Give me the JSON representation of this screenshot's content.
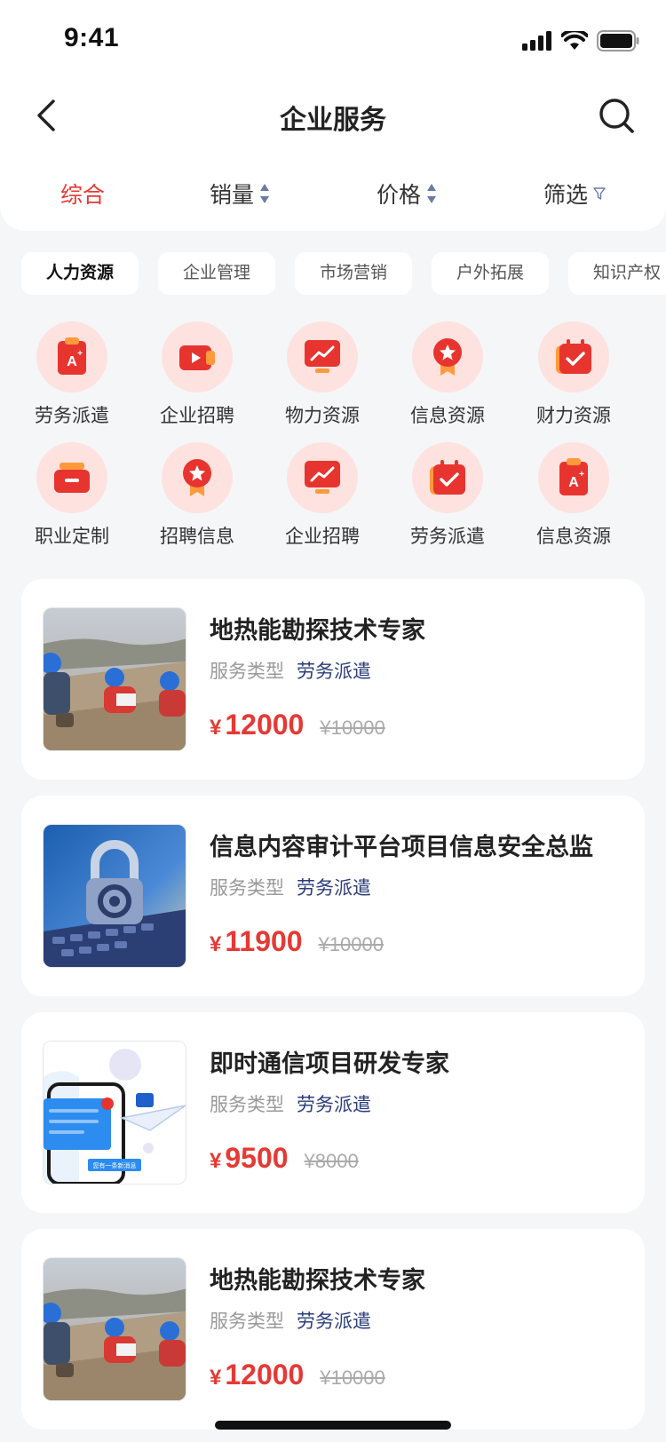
{
  "status": {
    "time": "9:41"
  },
  "nav": {
    "title": "企业服务"
  },
  "sort": {
    "items": [
      "综合",
      "销量",
      "价格",
      "筛选"
    ],
    "active_color": "#e53935"
  },
  "chips": [
    "人力资源",
    "企业管理",
    "市场营销",
    "户外拓展",
    "知识产权"
  ],
  "grid": [
    {
      "label": "劳务派遣",
      "icon": "document-a-icon"
    },
    {
      "label": "企业招聘",
      "icon": "video-icon"
    },
    {
      "label": "物力资源",
      "icon": "chart-icon"
    },
    {
      "label": "信息资源",
      "icon": "badge-star-icon"
    },
    {
      "label": "财力资源",
      "icon": "calendar-check-icon"
    },
    {
      "label": "职业定制",
      "icon": "toolbox-icon"
    },
    {
      "label": "招聘信息",
      "icon": "badge-star-icon"
    },
    {
      "label": "企业招聘",
      "icon": "chart-icon"
    },
    {
      "label": "劳务派遣",
      "icon": "calendar-check-icon"
    },
    {
      "label": "信息资源",
      "icon": "document-a-icon"
    }
  ],
  "cards": [
    {
      "title": "地热能勘探技术专家",
      "meta_label": "服务类型",
      "meta_value": "劳务派遣",
      "currency": "¥",
      "price": "12000",
      "old_price": "¥10000",
      "image": "workers-photo"
    },
    {
      "title": "信息内容审计平台项目信息安全总监",
      "meta_label": "服务类型",
      "meta_value": "劳务派遣",
      "currency": "¥",
      "price": "11900",
      "old_price": "¥10000",
      "image": "security-lock-photo"
    },
    {
      "title": "即时通信项目研发专家",
      "meta_label": "服务类型",
      "meta_value": "劳务派遣",
      "currency": "¥",
      "price": "9500",
      "old_price": "¥8000",
      "image": "messaging-illustration",
      "image_text": "您有一条新消息"
    },
    {
      "title": "地热能勘探技术专家",
      "meta_label": "服务类型",
      "meta_value": "劳务派遣",
      "currency": "¥",
      "price": "12000",
      "old_price": "¥10000",
      "image": "workers-photo"
    }
  ],
  "colors": {
    "accent": "#e53935",
    "meta_value": "#2c3e7a",
    "icon_bg": "#fde2e0"
  }
}
